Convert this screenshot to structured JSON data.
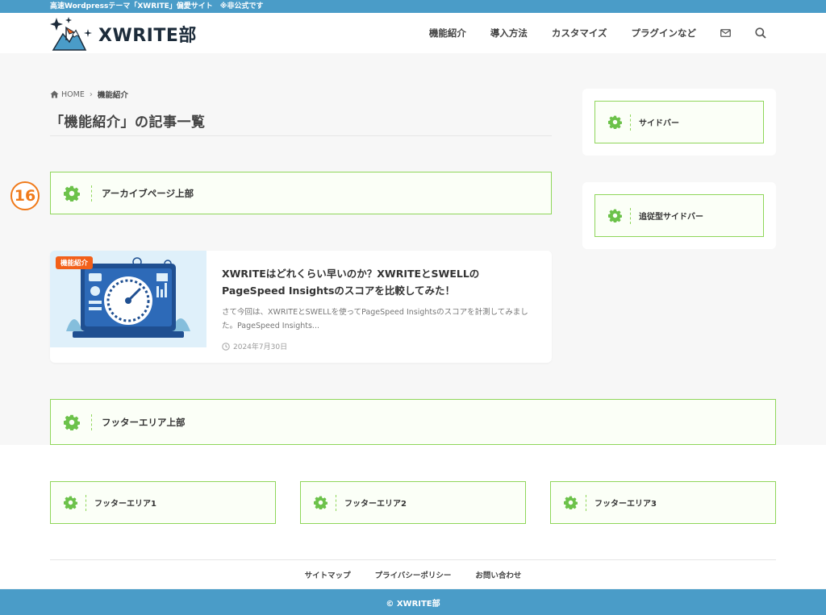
{
  "topbar": {
    "text": "高速Wordpressテーマ「XWRITE」偏愛サイト　※非公式です"
  },
  "header": {
    "logo_text": "XWRITE部",
    "nav": [
      "機能紹介",
      "導入方法",
      "カスタマイズ",
      "プラグインなど"
    ],
    "icons": [
      "mail-icon",
      "search-icon"
    ]
  },
  "breadcrumb": {
    "home": "HOME",
    "current": "機能紹介"
  },
  "page": {
    "title": "「機能紹介」の記事一覧",
    "marker": "16"
  },
  "widgets": {
    "archive_top": "アーカイブページ上部",
    "sidebar": "サイドバー",
    "sticky_sidebar": "追従型サイドバー",
    "footer_top": "フッターエリア上部",
    "footer1": "フッターエリア1",
    "footer2": "フッターエリア2",
    "footer3": "フッターエリア3"
  },
  "post": {
    "category": "機能紹介",
    "title": "XWRITEはどれくらい早いのか？XWRITEとSWELLのPageSpeed Insightsのスコアを比較してみた！",
    "excerpt": "さて今回は、XWRITEとSWELLを使ってPageSpeed Insightsのスコアを計測してみました。PageSpeed Insights...",
    "date": "2024年7月30日"
  },
  "footer": {
    "links": [
      "サイトマップ",
      "プライバシーポリシー",
      "お問い合わせ"
    ],
    "copyright": "© XWRITE部"
  },
  "colors": {
    "accent_blue": "#4a9cc8",
    "widget_green": "#8fd65a",
    "badge_orange": "#f2601a",
    "marker_orange": "#f07a1a"
  }
}
